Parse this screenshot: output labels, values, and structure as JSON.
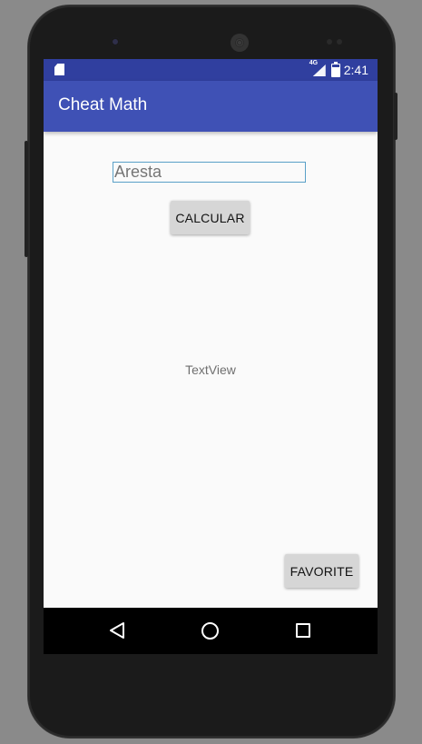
{
  "status_bar": {
    "time": "2:41",
    "network_label": "4G",
    "icons": [
      "sd-card-icon",
      "signal-icon",
      "battery-icon"
    ]
  },
  "app_bar": {
    "title": "Cheat Math",
    "color": "#3f51b5",
    "status_color": "#303f9f"
  },
  "content": {
    "input": {
      "value": "",
      "placeholder": "Aresta"
    },
    "calculate_button": "CALCULAR",
    "text_view": "TextView",
    "favorite_button": "FAVORITE"
  },
  "nav_bar": {
    "icons": [
      "back-icon",
      "home-icon",
      "recents-icon"
    ]
  }
}
